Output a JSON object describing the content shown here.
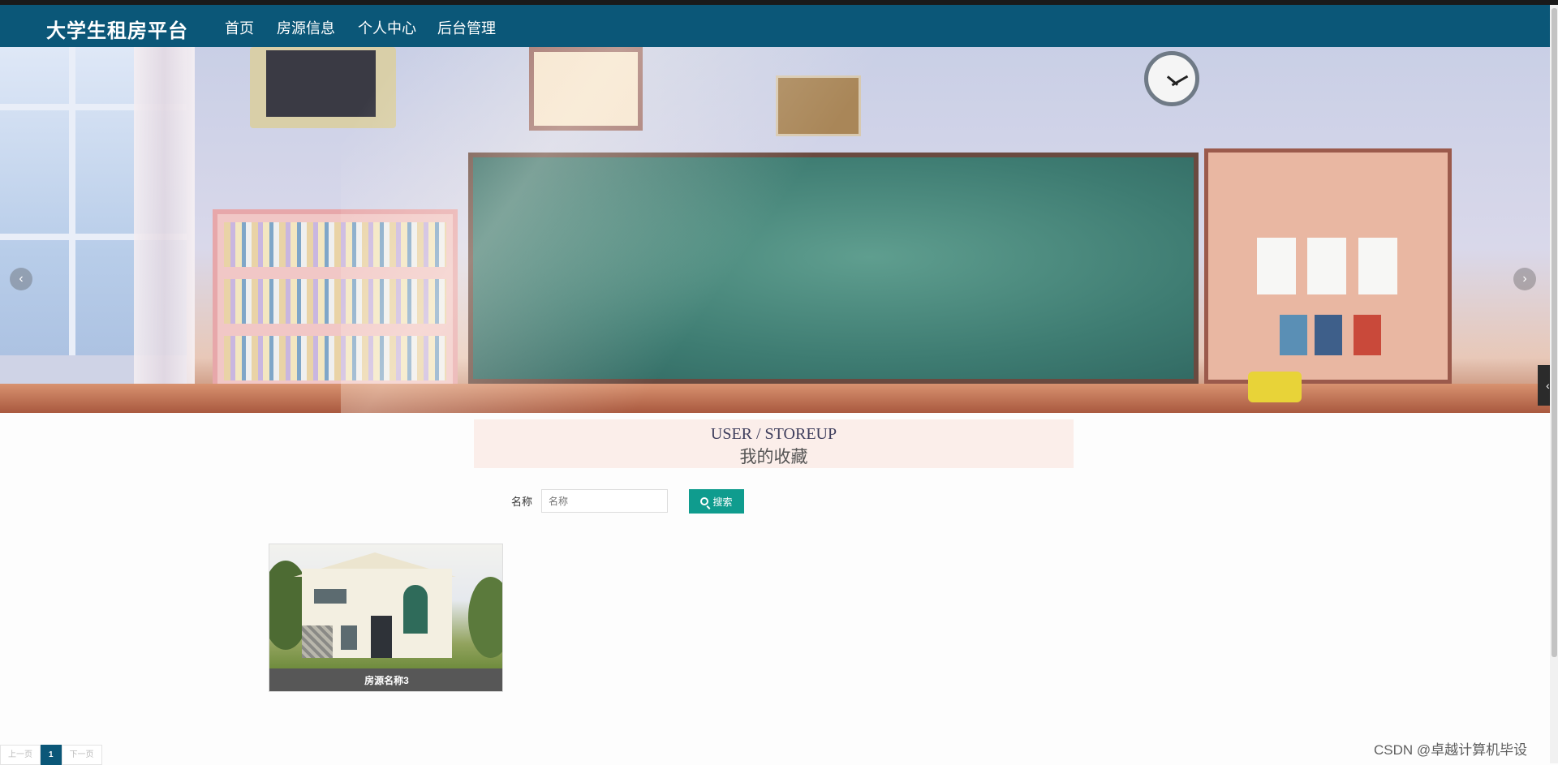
{
  "header": {
    "brand": "大学生租房平台",
    "nav": [
      {
        "label": "首页",
        "active": true
      },
      {
        "label": "房源信息",
        "active": false
      },
      {
        "label": "个人中心",
        "active": false
      },
      {
        "label": "后台管理",
        "active": false
      }
    ],
    "bar_color": "#0b5778"
  },
  "banner": {
    "prev_symbol": "‹",
    "next_symbol": "›",
    "slide_count": 3,
    "side_tab_symbol": "‹"
  },
  "title_box": {
    "en": "USER / STOREUP",
    "cn": "我的收藏"
  },
  "search": {
    "label": "名称",
    "placeholder": "名称",
    "button_label": "搜索",
    "button_color": "#0f9c8e"
  },
  "items": [
    {
      "name": "房源名称3"
    }
  ],
  "pagination": {
    "prev_label": "上一页",
    "current_page": "1",
    "next_label": "下一页"
  },
  "watermark": "CSDN @卓越计算机毕设"
}
